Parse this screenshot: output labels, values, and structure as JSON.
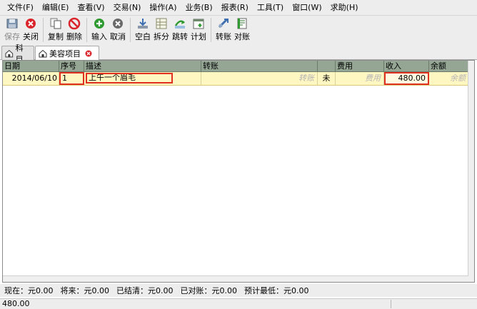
{
  "menu": [
    "文件(F)",
    "编辑(E)",
    "查看(V)",
    "交易(N)",
    "操作(A)",
    "业务(B)",
    "报表(R)",
    "工具(T)",
    "窗口(W)",
    "求助(H)"
  ],
  "toolbar": {
    "save": "保存",
    "close": "关闭",
    "copy": "复制",
    "delete": "删除",
    "enter": "输入",
    "cancel": "取消",
    "blank": "空白",
    "split": "拆分",
    "jump": "跳转",
    "schedule": "计划",
    "transfer": "转账",
    "reconcile": "对账"
  },
  "tabs": {
    "accounts": "科目",
    "beauty": "美容项目"
  },
  "columns": {
    "date": "日期",
    "num": "序号",
    "desc": "描述",
    "transfer": "转账",
    "r": "",
    "expense": "费用",
    "income": "收入",
    "balance": "余额"
  },
  "row": {
    "date": "2014/06/10",
    "num": "1",
    "desc": "上午一个眉毛",
    "transfer_hint": "转账",
    "reconcile": "未",
    "expense_hint": "费用",
    "income": "480.00",
    "balance_hint": "余额"
  },
  "summary": {
    "present": "现在：元0.00",
    "future": "将来：元0.00",
    "cleared": "已结清：元0.00",
    "reconciled": "已对账：元0.00",
    "projected_min": "预计最低：元0.00"
  },
  "status": "480.00",
  "colors": {
    "header": "#95a695",
    "row": "#fff7c2",
    "highlight": "#e03020"
  }
}
